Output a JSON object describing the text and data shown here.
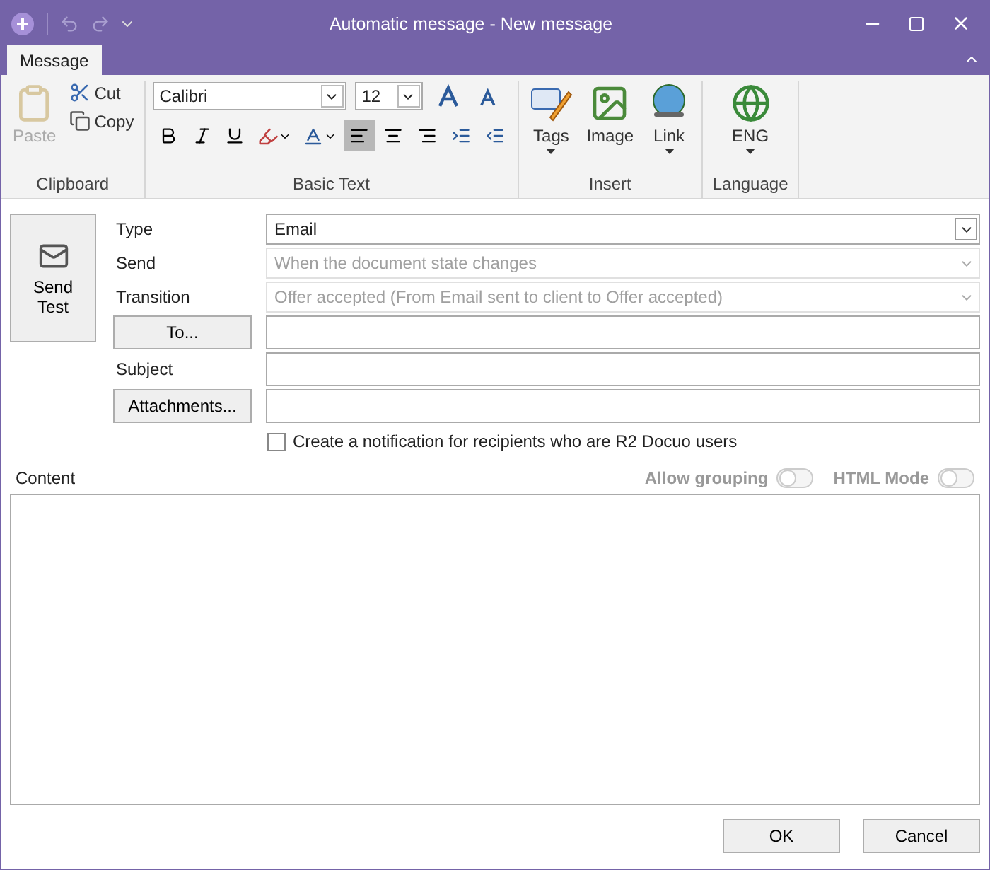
{
  "window": {
    "title": "Automatic message - New message"
  },
  "tabs": [
    {
      "label": "Message",
      "selected": true
    }
  ],
  "clipboard": {
    "paste": {
      "label": "Paste",
      "disabled": true
    },
    "cut": "Cut",
    "copy": "Copy",
    "group_label": "Clipboard"
  },
  "basic_text": {
    "font": "Calibri",
    "size": "12",
    "group_label": "Basic Text",
    "align": [
      {
        "kind": "left",
        "selected": true
      },
      {
        "kind": "center",
        "selected": false
      },
      {
        "kind": "right",
        "selected": false
      }
    ]
  },
  "insert": {
    "group_label": "Insert",
    "items": [
      {
        "kind": "tags",
        "label": "Tags",
        "dropdown": true
      },
      {
        "kind": "image",
        "label": "Image",
        "dropdown": false
      },
      {
        "kind": "link",
        "label": "Link",
        "dropdown": true
      }
    ]
  },
  "language": {
    "group_label": "Language",
    "label": "ENG"
  },
  "send_test": {
    "label": "Send Test"
  },
  "rows": [
    {
      "kind": "select",
      "label": "Type",
      "label_is_button": false,
      "value": "Email",
      "disabled": false
    },
    {
      "kind": "select",
      "label": "Send",
      "label_is_button": false,
      "value": "When the document state changes",
      "disabled": true
    },
    {
      "kind": "select",
      "label": "Transition",
      "label_is_button": false,
      "value": "Offer accepted (From Email sent to client to Offer accepted)",
      "disabled": true
    },
    {
      "kind": "text",
      "label": "To...",
      "label_is_button": true
    },
    {
      "kind": "text",
      "label": "Subject",
      "label_is_button": false
    },
    {
      "kind": "text",
      "label": "Attachments...",
      "label_is_button": true
    }
  ],
  "notify": {
    "label": "Create a notification for recipients who are R2 Docuo users",
    "checked": false
  },
  "content": {
    "label": "Content",
    "toggles": [
      {
        "label": "Allow grouping",
        "on": false
      },
      {
        "label": "HTML Mode",
        "on": false
      }
    ]
  },
  "buttons": [
    "OK",
    "Cancel"
  ]
}
